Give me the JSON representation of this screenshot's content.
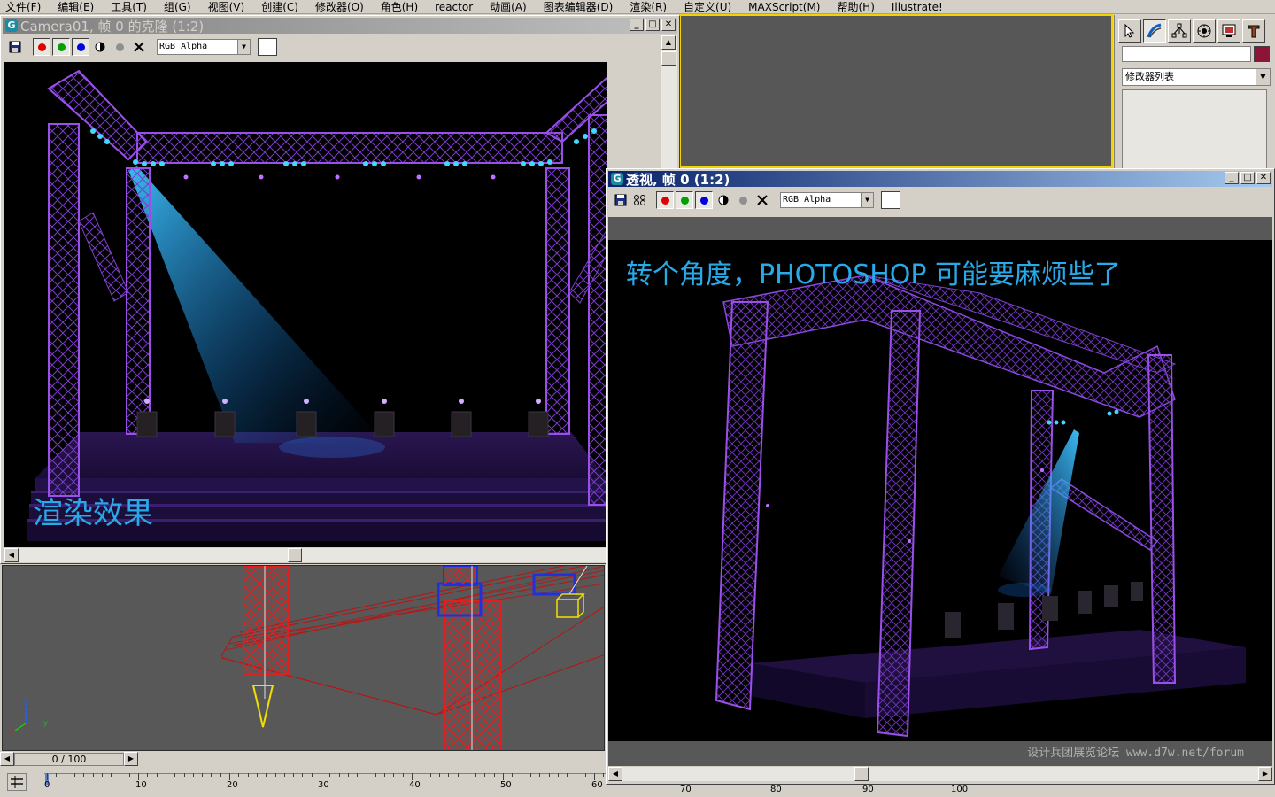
{
  "menu": [
    "文件(F)",
    "编辑(E)",
    "工具(T)",
    "组(G)",
    "视图(V)",
    "创建(C)",
    "修改器(O)",
    "角色(H)",
    "reactor",
    "动画(A)",
    "图表编辑器(D)",
    "渲染(R)",
    "自定义(U)",
    "MAXScript(M)",
    "帮助(H)",
    "Illustrate!"
  ],
  "command_panel": {
    "modifier_list": "修改器列表",
    "color_swatch": "#8c1436",
    "tabs": [
      "create-tab-icon",
      "modify-tab-icon",
      "hierarchy-tab-icon",
      "motion-tab-icon",
      "display-tab-icon",
      "utilities-tab-icon"
    ]
  },
  "window1": {
    "title": "Camera01, 帧 0 的克隆 (1:2)",
    "channel": "RGB Alpha",
    "caption": "渲染效果"
  },
  "window2": {
    "title": "透视, 帧 0 (1:2)",
    "channel": "RGB Alpha",
    "caption": "转个角度，PHOTOSHOP 可能要麻烦些了",
    "watermark": "设计兵团展览论坛 www.d7w.net/forum"
  },
  "timeslider": {
    "value": "0 / 100"
  },
  "track": {
    "labels": [
      "0",
      "10",
      "20",
      "30",
      "40",
      "50",
      "60"
    ],
    "right_labels": [
      "70",
      "80",
      "90",
      "100"
    ]
  },
  "colors": {
    "caption": "#28a9e8",
    "truss": "#8a3cd6",
    "beam": "#1fa8ff",
    "active_viewport": "#f2d300"
  }
}
